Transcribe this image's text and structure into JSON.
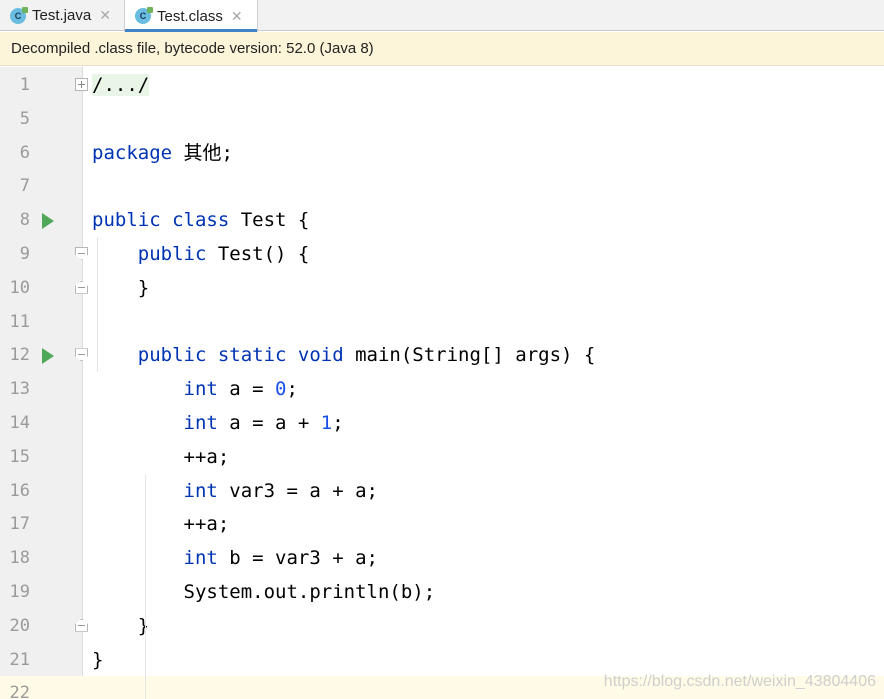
{
  "tabs": [
    {
      "label": "Test.java",
      "icon": "class-file-icon",
      "active": false
    },
    {
      "label": "Test.class",
      "icon": "class-file-icon",
      "active": true
    }
  ],
  "icon_letter": "C",
  "close_glyph": "✕",
  "notice": "Decompiled .class file, bytecode version: 52.0 (Java 8)",
  "colors": {
    "keyword": "#0033b3",
    "number": "#1750eb",
    "run": "#4fa85a",
    "active_tab": "#4083c9",
    "notice_bg": "#fcf5d9"
  },
  "lines": [
    {
      "n": "1",
      "run": false,
      "fold": "plus",
      "tokens": [
        [
          "fold-text",
          "/.../"
        ]
      ]
    },
    {
      "n": "5",
      "run": false,
      "fold": "",
      "tokens": []
    },
    {
      "n": "6",
      "run": false,
      "fold": "",
      "tokens": [
        [
          "kw",
          "package"
        ],
        [
          "",
          " 其他;"
        ]
      ]
    },
    {
      "n": "7",
      "run": false,
      "fold": "",
      "tokens": []
    },
    {
      "n": "8",
      "run": true,
      "fold": "",
      "tokens": [
        [
          "kw",
          "public class"
        ],
        [
          "",
          " Test {"
        ]
      ]
    },
    {
      "n": "9",
      "run": false,
      "fold": "start",
      "tokens": [
        [
          "",
          "    "
        ],
        [
          "kw",
          "public"
        ],
        [
          "",
          " Test() {"
        ]
      ]
    },
    {
      "n": "10",
      "run": false,
      "fold": "end",
      "tokens": [
        [
          "",
          "    }"
        ]
      ]
    },
    {
      "n": "11",
      "run": false,
      "fold": "",
      "tokens": []
    },
    {
      "n": "12",
      "run": true,
      "fold": "start",
      "tokens": [
        [
          "",
          "    "
        ],
        [
          "kw",
          "public static void"
        ],
        [
          "",
          " main(String[] args) {"
        ]
      ]
    },
    {
      "n": "13",
      "run": false,
      "fold": "",
      "tokens": [
        [
          "",
          "        "
        ],
        [
          "kw",
          "int"
        ],
        [
          "",
          " a = "
        ],
        [
          "num",
          "0"
        ],
        [
          "",
          ";"
        ]
      ]
    },
    {
      "n": "14",
      "run": false,
      "fold": "",
      "tokens": [
        [
          "",
          "        "
        ],
        [
          "kw",
          "int"
        ],
        [
          "",
          " a = a + "
        ],
        [
          "num",
          "1"
        ],
        [
          "",
          ";"
        ]
      ]
    },
    {
      "n": "15",
      "run": false,
      "fold": "",
      "tokens": [
        [
          "",
          "        ++a;"
        ]
      ]
    },
    {
      "n": "16",
      "run": false,
      "fold": "",
      "tokens": [
        [
          "",
          "        "
        ],
        [
          "kw",
          "int"
        ],
        [
          "",
          " var3 = a + a;"
        ]
      ]
    },
    {
      "n": "17",
      "run": false,
      "fold": "",
      "tokens": [
        [
          "",
          "        ++a;"
        ]
      ]
    },
    {
      "n": "18",
      "run": false,
      "fold": "",
      "tokens": [
        [
          "",
          "        "
        ],
        [
          "kw",
          "int"
        ],
        [
          "",
          " b = var3 + a;"
        ]
      ]
    },
    {
      "n": "19",
      "run": false,
      "fold": "",
      "tokens": [
        [
          "",
          "        System.out.println(b);"
        ]
      ]
    },
    {
      "n": "20",
      "run": false,
      "fold": "end",
      "tokens": [
        [
          "",
          "    }"
        ]
      ]
    },
    {
      "n": "21",
      "run": false,
      "fold": "",
      "tokens": [
        [
          "",
          "}"
        ]
      ]
    },
    {
      "n": "22",
      "run": false,
      "fold": "",
      "tokens": []
    }
  ],
  "watermark": "https://blog.csdn.net/weixin_43804406"
}
